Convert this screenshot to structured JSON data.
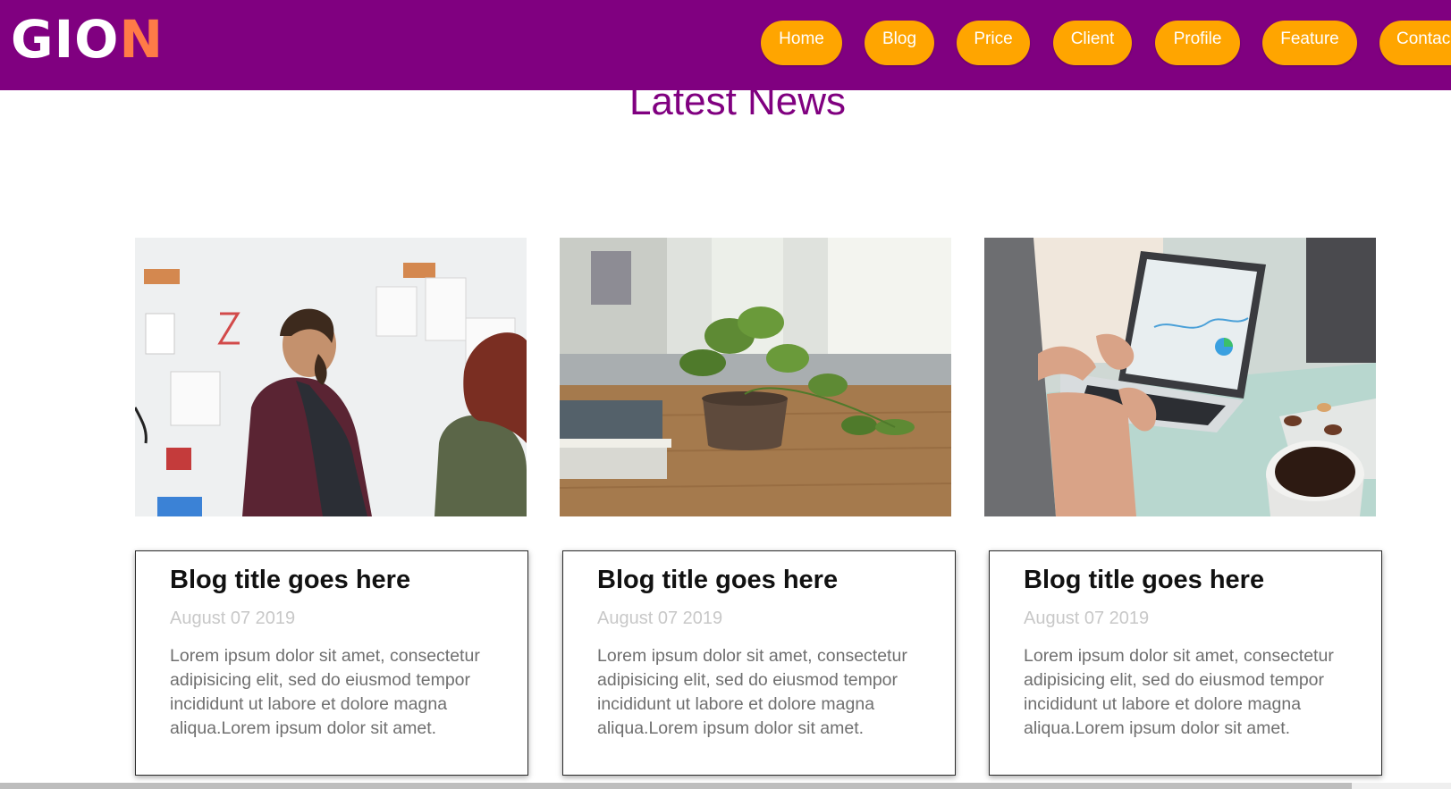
{
  "header": {
    "logo": {
      "main": "GIO",
      "accent": "N"
    },
    "nav": [
      {
        "label": "Home"
      },
      {
        "label": "Blog"
      },
      {
        "label": "Price"
      },
      {
        "label": "Client"
      },
      {
        "label": "Profile"
      },
      {
        "label": "Feature"
      },
      {
        "label": "Contac"
      }
    ]
  },
  "section": {
    "title": "Latest News"
  },
  "posts": [
    {
      "image": "people-at-whiteboard-photo",
      "title": "Blog title goes here",
      "date": "August 07 2019",
      "text": "Lorem ipsum dolor sit amet, consectetur adipisicing elit, sed do eiusmod tempor incididunt ut labore et dolore magna aliqua.Lorem ipsum dolor sit amet."
    },
    {
      "image": "plant-on-table-photo",
      "title": "Blog title goes here",
      "date": "August 07 2019",
      "text": "Lorem ipsum dolor sit amet, consectetur adipisicing elit, sed do eiusmod tempor incididunt ut labore et dolore magna aliqua.Lorem ipsum dolor sit amet."
    },
    {
      "image": "laptop-and-coffee-photo",
      "title": "Blog title goes here",
      "date": "August 07 2019",
      "text": "Lorem ipsum dolor sit amet, consectetur adipisicing elit, sed do eiusmod tempor incididunt ut labore et dolore magna aliqua.Lorem ipsum dolor sit amet."
    }
  ],
  "colors": {
    "header_bg": "#800080",
    "nav_button": "#ffa500",
    "title": "#800080",
    "logo_accent": "#ff7b47"
  }
}
